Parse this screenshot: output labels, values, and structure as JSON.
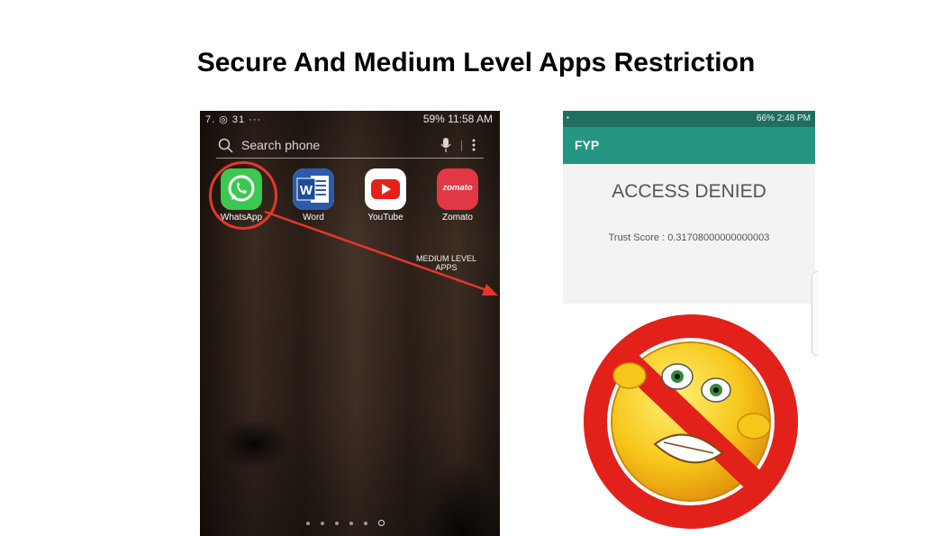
{
  "slide": {
    "title": "Secure And Medium Level Apps Restriction"
  },
  "left_phone": {
    "status_left": "7. ◎ 31 ···",
    "status_right": "59%  11:58 AM",
    "search_placeholder": "Search phone",
    "apps": [
      {
        "label": "WhatsApp"
      },
      {
        "label": "Word"
      },
      {
        "label": "YouTube"
      },
      {
        "label": "Zomato",
        "tile_text": "zomato"
      }
    ],
    "annotation": {
      "line1": "MEDIUM LEVEL",
      "line2": "APPS",
      "color": "#e8362b"
    },
    "page_dots": 6,
    "current_page": 6
  },
  "right_phone": {
    "status_right": "66%  2:48 PM",
    "app_title": "FYP",
    "message": "ACCESS DENIED",
    "trust_score": "Trust Score : 0.31708000000000003",
    "colors": {
      "statusbar": "#1f6f5f",
      "appbar": "#279583"
    }
  },
  "icons": [
    "search-icon",
    "mic-icon",
    "more-icon",
    "whatsapp-icon",
    "word-icon",
    "youtube-icon",
    "prohibited-emoji"
  ]
}
